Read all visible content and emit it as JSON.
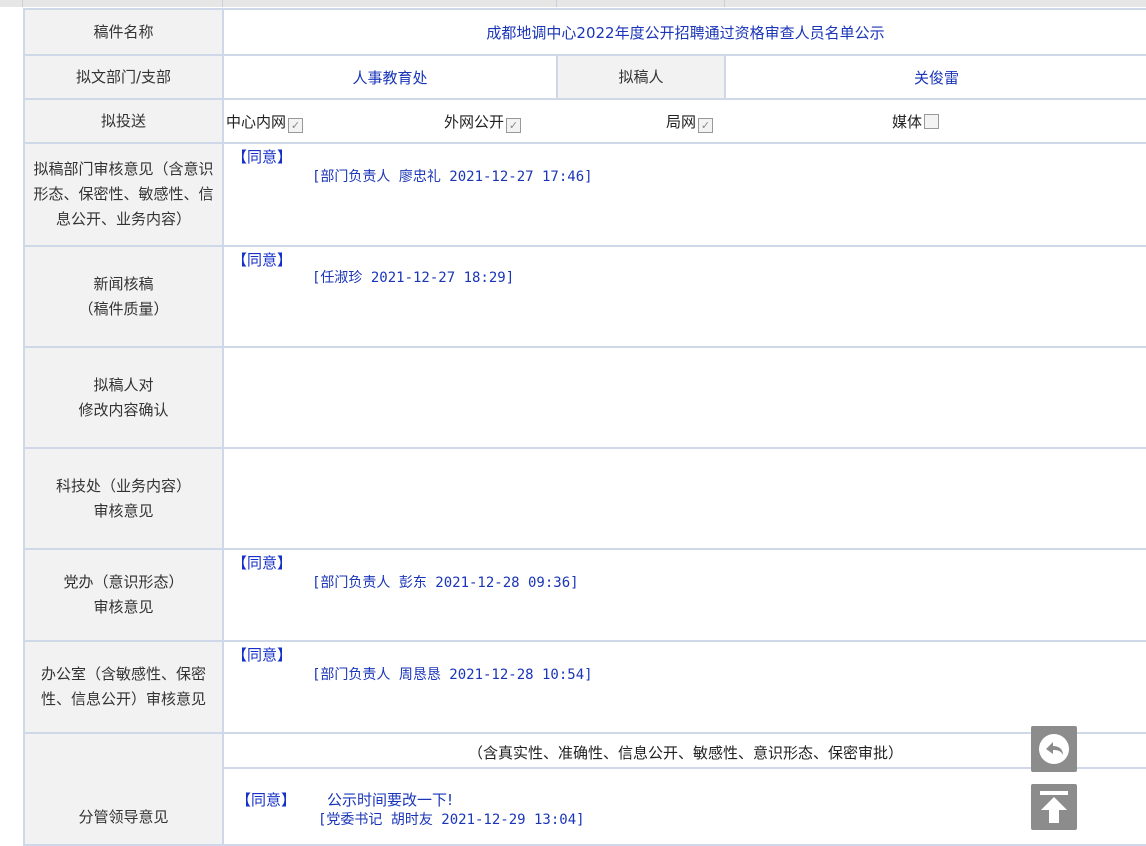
{
  "form": {
    "title_label": "稿件名称",
    "title_value": "成都地调中心2022年度公开招聘通过资格审查人员名单公示",
    "dept_label": "拟文部门/支部",
    "dept_value": "人事教育处",
    "drafter_label": "拟稿人",
    "drafter_value": "关俊雷",
    "send_label": "拟投送",
    "send_options": [
      {
        "label": "中心内网",
        "checked": true
      },
      {
        "label": "外网公开",
        "checked": true
      },
      {
        "label": "局网",
        "checked": true
      },
      {
        "label": "媒体",
        "checked": false
      }
    ]
  },
  "reviews": [
    {
      "label": "拟稿部门审核意见（含意识形态、保密性、敏感性、信息公开、业务内容）",
      "agree": "【同意】",
      "sign": "[部门负责人 廖忠礼 2021-12-27 17:46]"
    },
    {
      "label_line1": "新闻核稿",
      "label_line2": "（稿件质量）",
      "agree": "【同意】",
      "sign": "[任淑珍 2021-12-27 18:29]"
    },
    {
      "label_line1": "拟稿人对",
      "label_line2": "修改内容确认",
      "agree": "",
      "sign": ""
    },
    {
      "label_line1": "科技处（业务内容）",
      "label_line2": "审核意见",
      "agree": "",
      "sign": ""
    },
    {
      "label_line1": "党办（意识形态）",
      "label_line2": "审核意见",
      "agree": "【同意】",
      "sign": "[部门负责人 彭东 2021-12-28 09:36]"
    },
    {
      "label": "办公室（含敏感性、保密性、信息公开）审核意见",
      "agree": "【同意】",
      "sign": "[部门负责人 周恳恳 2021-12-28 10:54]"
    }
  ],
  "leader": {
    "label": "分管领导意见",
    "scope_note": "（含真实性、准确性、信息公开、敏感性、意识形态、保密审批）",
    "agree": "【同意】",
    "comment": "公示时间要改一下!",
    "sign": "[党委书记 胡时友 2021-12-29 13:04]"
  },
  "floating": {
    "back_icon": "reply-arrow-icon",
    "top_icon": "back-to-top-icon"
  }
}
